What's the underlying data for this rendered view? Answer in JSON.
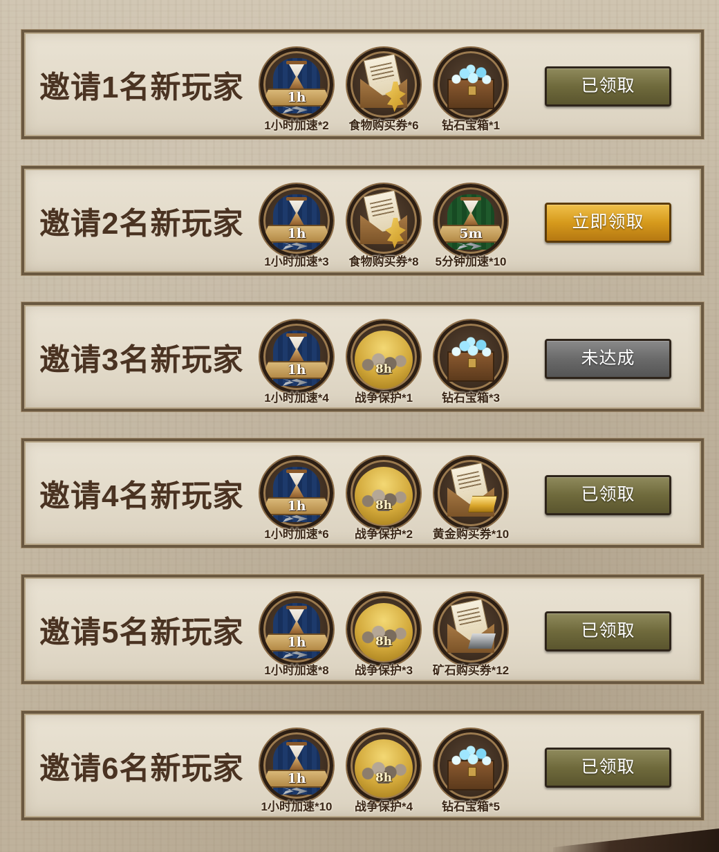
{
  "rows": [
    {
      "title": "邀请1名新玩家",
      "rewards": [
        {
          "icon": "speedup-1h-icon",
          "badge": "1h",
          "label": "1小时加速*2"
        },
        {
          "icon": "food-voucher-icon",
          "label": "食物购买券*6"
        },
        {
          "icon": "diamond-chest-icon",
          "label": "钻石宝箱*1"
        }
      ],
      "button": {
        "label": "已领取",
        "state": "claimed"
      }
    },
    {
      "title": "邀请2名新玩家",
      "rewards": [
        {
          "icon": "speedup-1h-icon",
          "badge": "1h",
          "label": "1小时加速*3"
        },
        {
          "icon": "food-voucher-icon",
          "label": "食物购买券*8"
        },
        {
          "icon": "speedup-5m-icon",
          "badge": "5m",
          "label": "5分钟加速*10"
        }
      ],
      "button": {
        "label": "立即领取",
        "state": "claim"
      }
    },
    {
      "title": "邀请3名新玩家",
      "rewards": [
        {
          "icon": "speedup-1h-icon",
          "badge": "1h",
          "label": "1小时加速*4"
        },
        {
          "icon": "war-protection-icon",
          "badge": "8h",
          "label": "战争保护*1"
        },
        {
          "icon": "diamond-chest-icon",
          "label": "钻石宝箱*3"
        }
      ],
      "button": {
        "label": "未达成",
        "state": "locked"
      }
    },
    {
      "title": "邀请4名新玩家",
      "rewards": [
        {
          "icon": "speedup-1h-icon",
          "badge": "1h",
          "label": "1小时加速*6"
        },
        {
          "icon": "war-protection-icon",
          "badge": "8h",
          "label": "战争保护*2"
        },
        {
          "icon": "gold-voucher-icon",
          "label": "黄金购买券*10"
        }
      ],
      "button": {
        "label": "已领取",
        "state": "claimed"
      }
    },
    {
      "title": "邀请5名新玩家",
      "rewards": [
        {
          "icon": "speedup-1h-icon",
          "badge": "1h",
          "label": "1小时加速*8"
        },
        {
          "icon": "war-protection-icon",
          "badge": "8h",
          "label": "战争保护*3"
        },
        {
          "icon": "ore-voucher-icon",
          "label": "矿石购买券*12"
        }
      ],
      "button": {
        "label": "已领取",
        "state": "claimed"
      }
    },
    {
      "title": "邀请6名新玩家",
      "rewards": [
        {
          "icon": "speedup-1h-icon",
          "badge": "1h",
          "label": "1小时加速*10"
        },
        {
          "icon": "war-protection-icon",
          "badge": "8h",
          "label": "战争保护*4"
        },
        {
          "icon": "diamond-chest-icon",
          "label": "钻石宝箱*5"
        }
      ],
      "button": {
        "label": "已领取",
        "state": "claimed"
      }
    }
  ],
  "colors": {
    "claimed": "#6f6a3c",
    "claim": "#d69a1c",
    "locked": "#6a6a6a",
    "title": "#4a3322"
  }
}
